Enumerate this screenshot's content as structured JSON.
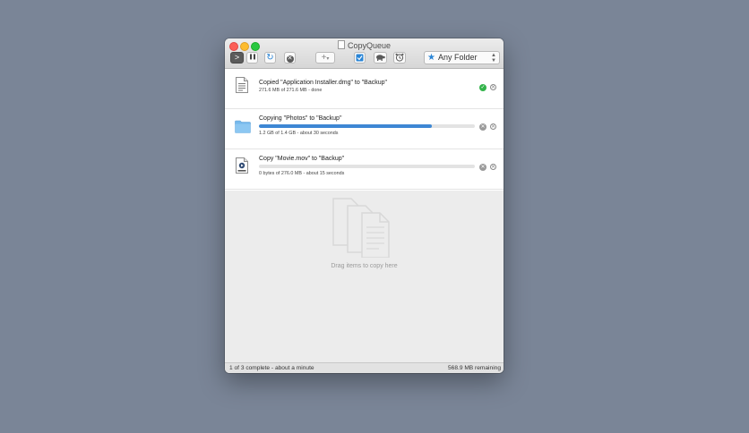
{
  "window": {
    "title": "CopyQueue"
  },
  "toolbar": {
    "start_glyph": ">",
    "pause_glyph": "❚❚",
    "refresh_glyph": "↻",
    "stop_glyph": "✕",
    "add_glyph": "+",
    "add_menu_glyph": "▾",
    "folder_select": {
      "selected": "Any Folder"
    }
  },
  "items": [
    {
      "title": "Copied \"Application Installer.dmg\" to \"Backup\"",
      "status": "271.6 MB of 271.6 MB - done",
      "state": "done",
      "icon": "dmg-file-icon"
    },
    {
      "title": "Copying \"Photos\" to \"Backup\"",
      "status": "1.2 GB of 1.4 GB - about 30 seconds",
      "state": "copying",
      "progress": 0.8,
      "icon": "folder-icon"
    },
    {
      "title": "Copy \"Movie.mov\" to \"Backup\"",
      "status": "0 bytes of 276.0 MB - about 15 seconds",
      "state": "queued",
      "progress": 0.0,
      "icon": "movie-file-icon"
    }
  ],
  "drop_area": {
    "hint": "Drag items to copy here"
  },
  "statusbar": {
    "left": "1 of 3 complete - about a minute",
    "right": "568.9 MB remaining"
  },
  "colors": {
    "desktop": "#7a8597",
    "accent": "#3d87d4",
    "done": "#32b34a"
  }
}
